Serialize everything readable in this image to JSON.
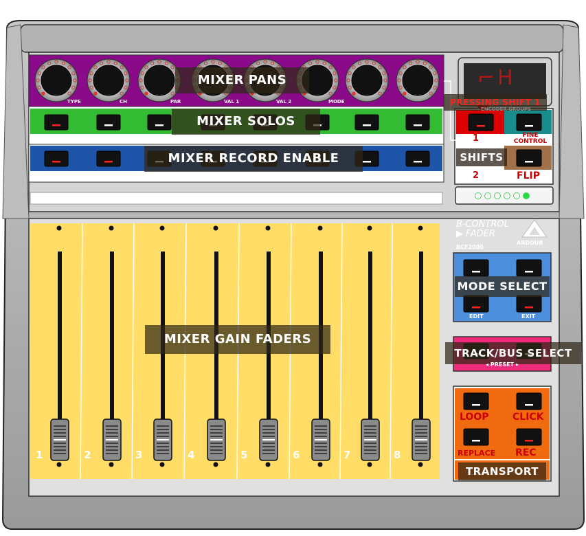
{
  "controller": {
    "brand_line1": "B-CONTROL",
    "brand_line2": "FADER",
    "model": "BCF2000",
    "maker": "ARDOUR",
    "display_text": "⌐H"
  },
  "zones": {
    "pans": "MIXER PANS",
    "solos": "MIXER SOLOS",
    "record": "MIXER RECORD ENABLE",
    "faders": "MIXER GAIN FADERS",
    "mode_select": "MODE SELECT",
    "track_select": "TRACK/BUS SELECT",
    "transport": "TRANSPORT",
    "shifts": "SHIFTS",
    "pressing_shift": "PRESSING SHIFT 1"
  },
  "encoder_labels": [
    "TYPE",
    "CH",
    "PAR",
    "VAL 1",
    "VAL 2",
    "MODE",
    "",
    ""
  ],
  "fader_numbers": [
    "1",
    "2",
    "3",
    "4",
    "5",
    "6",
    "7",
    "8"
  ],
  "encoder_group_caption": "ENCODER GROUPS",
  "shift_buttons": {
    "b1": "1",
    "fine": "FINE CONTROL",
    "b2": "2",
    "flip": "FLIP"
  },
  "mode_buttons": {
    "edit": "EDIT",
    "exit": "EXIT"
  },
  "preset_caption": "◂  PRESET  ▸",
  "transport_buttons": {
    "loop": "LOOP",
    "click": "CLICK",
    "replace": "REPLACE",
    "rec": "REC"
  },
  "colors": {
    "pans": "#8a0a8a",
    "solos": "#33bb33",
    "record": "#1f55a8",
    "faders": "#ffdd66",
    "mode": "#4d8fdd",
    "select": "#ee2a7a",
    "transport": "#f06a10",
    "fine": "#1b8c8c",
    "flip": "#a0704a",
    "shift_red": "#dd0000"
  }
}
